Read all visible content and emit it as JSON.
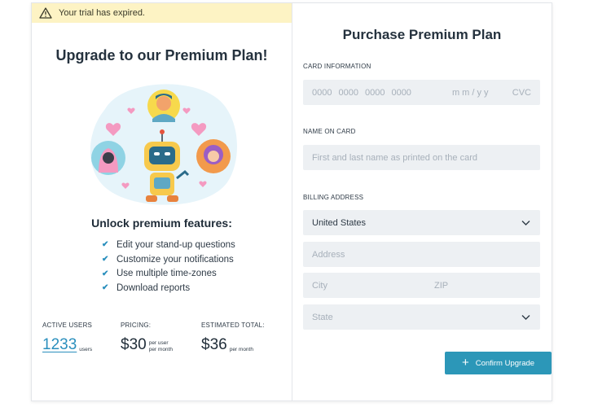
{
  "banner": {
    "text": "Your trial has expired.",
    "icon": "warning-icon"
  },
  "left": {
    "title": "Upgrade to our Premium Plan!",
    "unlock_title": "Unlock premium features:",
    "features": [
      "Edit your stand-up questions",
      "Customize your notifications",
      "Use multiple time-zones",
      "Download reports"
    ],
    "stats": {
      "active_users": {
        "label": "ACTIVE USERS",
        "value": "1233",
        "unit": "users"
      },
      "pricing": {
        "label": "PRICING:",
        "value": "$30",
        "unit_line1": "per user",
        "unit_line2": "per month"
      },
      "estimated_total": {
        "label": "ESTIMATED TOTAL:",
        "value": "$36",
        "unit": "per month"
      }
    }
  },
  "right": {
    "title": "Purchase Premium Plan",
    "card_info": {
      "label": "CARD INFORMATION",
      "number_groups": [
        "0000",
        "0000",
        "0000",
        "0000"
      ],
      "expiry_placeholder": "m m / y y",
      "cvc_placeholder": "CVC"
    },
    "name_on_card": {
      "label": "NAME ON CARD",
      "placeholder": "First and last name as printed on the card"
    },
    "billing": {
      "label": "BILLING ADDRESS",
      "country": "United States",
      "address_placeholder": "Address",
      "city_placeholder": "City",
      "zip_placeholder": "ZIP",
      "state_placeholder": "State"
    },
    "confirm_label": "Confirm Upgrade"
  },
  "colors": {
    "accent": "#2c97b8",
    "link": "#2a8fbd",
    "banner_bg": "#fdf3c4",
    "field_bg": "#edf0f3"
  }
}
